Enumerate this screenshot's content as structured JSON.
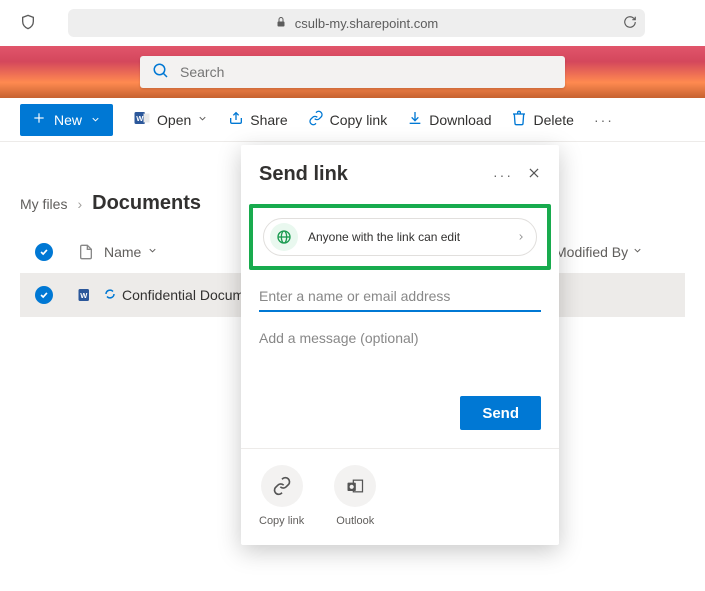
{
  "browser": {
    "url": "csulb-my.sharepoint.com"
  },
  "search": {
    "placeholder": "Search"
  },
  "toolbar": {
    "new_label": "New",
    "open_label": "Open",
    "share_label": "Share",
    "copylink_label": "Copy link",
    "download_label": "Download",
    "delete_label": "Delete"
  },
  "breadcrumb": {
    "parent": "My files",
    "current": "Documents"
  },
  "columns": {
    "name": "Name",
    "modified_by": "Modified By"
  },
  "files": [
    {
      "name": "Confidential Docum"
    }
  ],
  "share_dialog": {
    "title": "Send link",
    "link_scope": "Anyone with the link can edit",
    "email_placeholder": "Enter a name or email address",
    "message_placeholder": "Add a message (optional)",
    "send_label": "Send",
    "copy_label": "Copy link",
    "outlook_label": "Outlook"
  }
}
